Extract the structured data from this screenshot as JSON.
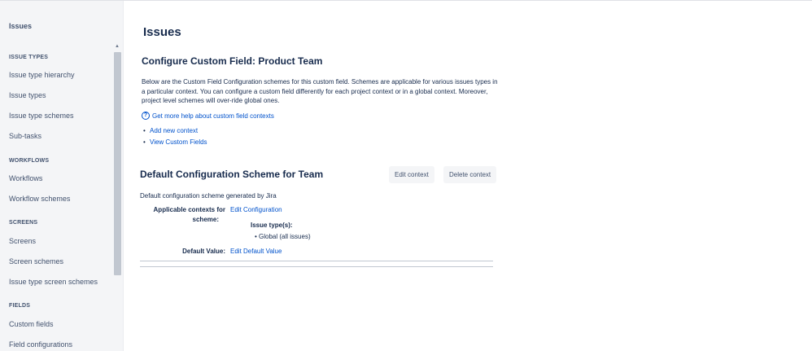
{
  "sidebar": {
    "title": "Issues",
    "sections": [
      {
        "heading": "ISSUE TYPES",
        "items": [
          "Issue type hierarchy",
          "Issue types",
          "Issue type schemes",
          "Sub-tasks"
        ]
      },
      {
        "heading": "WORKFLOWS",
        "items": [
          "Workflows",
          "Workflow schemes"
        ]
      },
      {
        "heading": "SCREENS",
        "items": [
          "Screens",
          "Screen schemes",
          "Issue type screen schemes"
        ]
      },
      {
        "heading": "FIELDS",
        "items": [
          "Custom fields",
          "Field configurations"
        ]
      }
    ]
  },
  "main": {
    "page_title": "Issues",
    "config_title": "Configure Custom Field: Product Team",
    "description": "Below are the Custom Field Configuration schemes for this custom field. Schemes are applicable for various issues types in a particular context. You can configure a custom field differently for each project context or in a global context. Moreover, project level schemes will over-ride global ones.",
    "help_link": "Get more help about custom field contexts",
    "links": [
      "Add new context",
      "View Custom Fields"
    ],
    "scheme": {
      "title": "Default Configuration Scheme for Team",
      "edit_button": "Edit context",
      "delete_button": "Delete context",
      "description": "Default configuration scheme generated by Jira",
      "contexts_label_line1": "Applicable contexts for",
      "contexts_label_line2": "scheme:",
      "edit_configuration": "Edit Configuration",
      "issue_types_label": "Issue type(s):",
      "issue_type_item": "Global (all issues)",
      "default_value_label": "Default Value:",
      "edit_default_value": "Edit Default Value"
    }
  }
}
